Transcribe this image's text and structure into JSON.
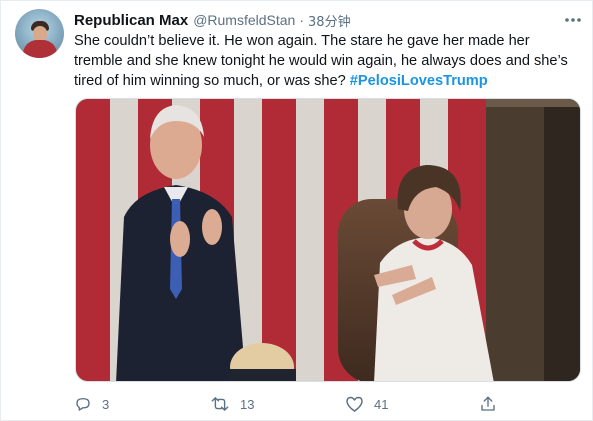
{
  "tweet": {
    "display_name": "Republican Max",
    "handle": "@RumsfeldStan",
    "separator": "·",
    "time_ago": "38分钟",
    "text": "She couldn’t believe it. He won again. The stare he gave her made her tremble and she knew tonight he would win again, he always does and she’s tired of him winning so much, or was she? ",
    "hashtag": "#PelosiLovesTrump",
    "more_icon": "more-horizontal-icon",
    "media_image": "photo-people-applauding-flag-background"
  },
  "actions": {
    "reply": {
      "icon": "reply-icon",
      "count": "3"
    },
    "retweet": {
      "icon": "retweet-icon",
      "count": "13"
    },
    "like": {
      "icon": "heart-icon",
      "count": "41"
    },
    "share": {
      "icon": "share-icon"
    }
  },
  "colors": {
    "text": "#0f1419",
    "secondary": "#5b7083",
    "link": "#1b95e0",
    "border": "#e6ecf0"
  }
}
